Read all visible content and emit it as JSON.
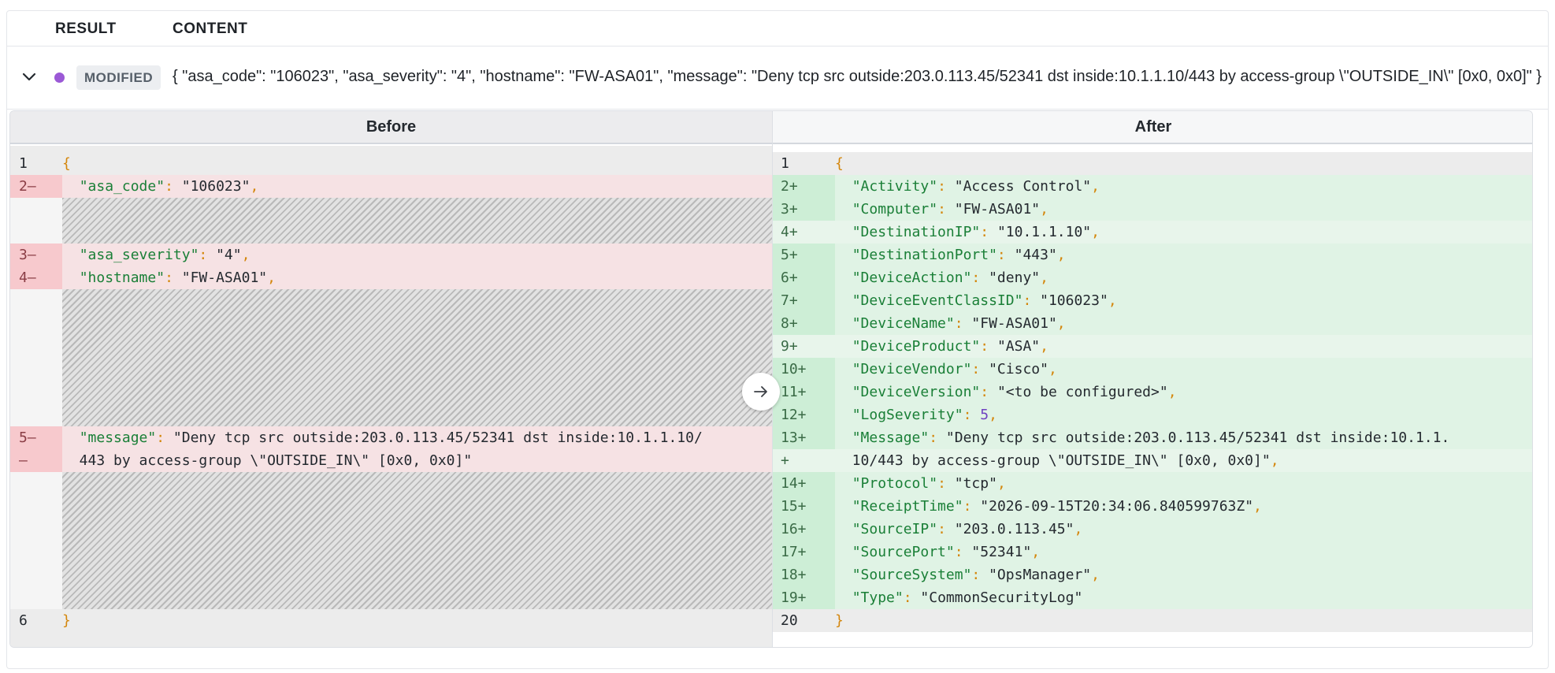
{
  "header": {
    "result_label": "RESULT",
    "content_label": "CONTENT"
  },
  "summary": {
    "badge": "MODIFIED",
    "text": "{ \"asa_code\": \"106023\", \"asa_severity\": \"4\", \"hostname\": \"FW-ASA01\", \"message\": \"Deny tcp src outside:203.0.113.45/52341 dst inside:10.1.1.10/443 by access-group \\\"OUTSIDE_IN\\\" [0x0, 0x0]\" }"
  },
  "diff": {
    "before_title": "Before",
    "after_title": "After",
    "before": [
      {
        "num": "1",
        "open": "{"
      },
      {
        "num": "2—",
        "key": "\"asa_code\"",
        "val": "\"106023\"",
        "comma": ","
      },
      {
        "num": "3—",
        "key": "\"asa_severity\"",
        "val": "\"4\"",
        "comma": ","
      },
      {
        "num": "4—",
        "key": "\"hostname\"",
        "val": "\"FW-ASA01\"",
        "comma": ","
      },
      {
        "num": "5—",
        "key": "\"message\"",
        "val": "\"Deny tcp src outside:203.0.113.45/52341 dst inside:10.1.1.10/"
      },
      {
        "num": "—",
        "cont": "443 by access-group \\\"OUTSIDE_IN\\\" [0x0, 0x0]\""
      },
      {
        "num": "6",
        "close": "}"
      }
    ],
    "after": [
      {
        "num": "1",
        "open": "{"
      },
      {
        "num": "2+",
        "key": "\"Activity\"",
        "val": "\"Access Control\"",
        "comma": ","
      },
      {
        "num": "3+",
        "key": "\"Computer\"",
        "val": "\"FW-ASA01\"",
        "comma": ","
      },
      {
        "num": "4+",
        "key": "\"DestinationIP\"",
        "val": "\"10.1.1.10\"",
        "comma": ","
      },
      {
        "num": "5+",
        "key": "\"DestinationPort\"",
        "val": "\"443\"",
        "comma": ","
      },
      {
        "num": "6+",
        "key": "\"DeviceAction\"",
        "val": "\"deny\"",
        "comma": ","
      },
      {
        "num": "7+",
        "key": "\"DeviceEventClassID\"",
        "val": "\"106023\"",
        "comma": ","
      },
      {
        "num": "8+",
        "key": "\"DeviceName\"",
        "val": "\"FW-ASA01\"",
        "comma": ","
      },
      {
        "num": "9+",
        "key": "\"DeviceProduct\"",
        "val": "\"ASA\"",
        "comma": ","
      },
      {
        "num": "10+",
        "key": "\"DeviceVendor\"",
        "val": "\"Cisco\"",
        "comma": ","
      },
      {
        "num": "11+",
        "key": "\"DeviceVersion\"",
        "val": "\"<to be configured>\"",
        "comma": ","
      },
      {
        "num": "12+",
        "key": "\"LogSeverity\"",
        "num_val": "5",
        "comma": ","
      },
      {
        "num": "13+",
        "key": "\"Message\"",
        "val": "\"Deny tcp src outside:203.0.113.45/52341 dst inside:10.1.1."
      },
      {
        "num": "+",
        "cont": "10/443 by access-group \\\"OUTSIDE_IN\\\" [0x0, 0x0]\"",
        "comma": ","
      },
      {
        "num": "14+",
        "key": "\"Protocol\"",
        "val": "\"tcp\"",
        "comma": ","
      },
      {
        "num": "15+",
        "key": "\"ReceiptTime\"",
        "val": "\"2026-09-15T20:34:06.840599763Z\"",
        "comma": ","
      },
      {
        "num": "16+",
        "key": "\"SourceIP\"",
        "val": "\"203.0.113.45\"",
        "comma": ","
      },
      {
        "num": "17+",
        "key": "\"SourcePort\"",
        "val": "\"52341\"",
        "comma": ","
      },
      {
        "num": "18+",
        "key": "\"SourceSystem\"",
        "val": "\"OpsManager\"",
        "comma": ","
      },
      {
        "num": "19+",
        "key": "\"Type\"",
        "val": "\"CommonSecurityLog\""
      },
      {
        "num": "20",
        "close": "}"
      }
    ]
  },
  "icons": {
    "expand": "chevron-down-icon",
    "status": "status-dot-icon",
    "swap": "arrow-right-icon"
  },
  "colors": {
    "status_dot": "#9b59d6",
    "deleted": "#f6e2e4",
    "added": "#e0f3e5",
    "key": "#1a7f37",
    "punct": "#d4860b"
  }
}
